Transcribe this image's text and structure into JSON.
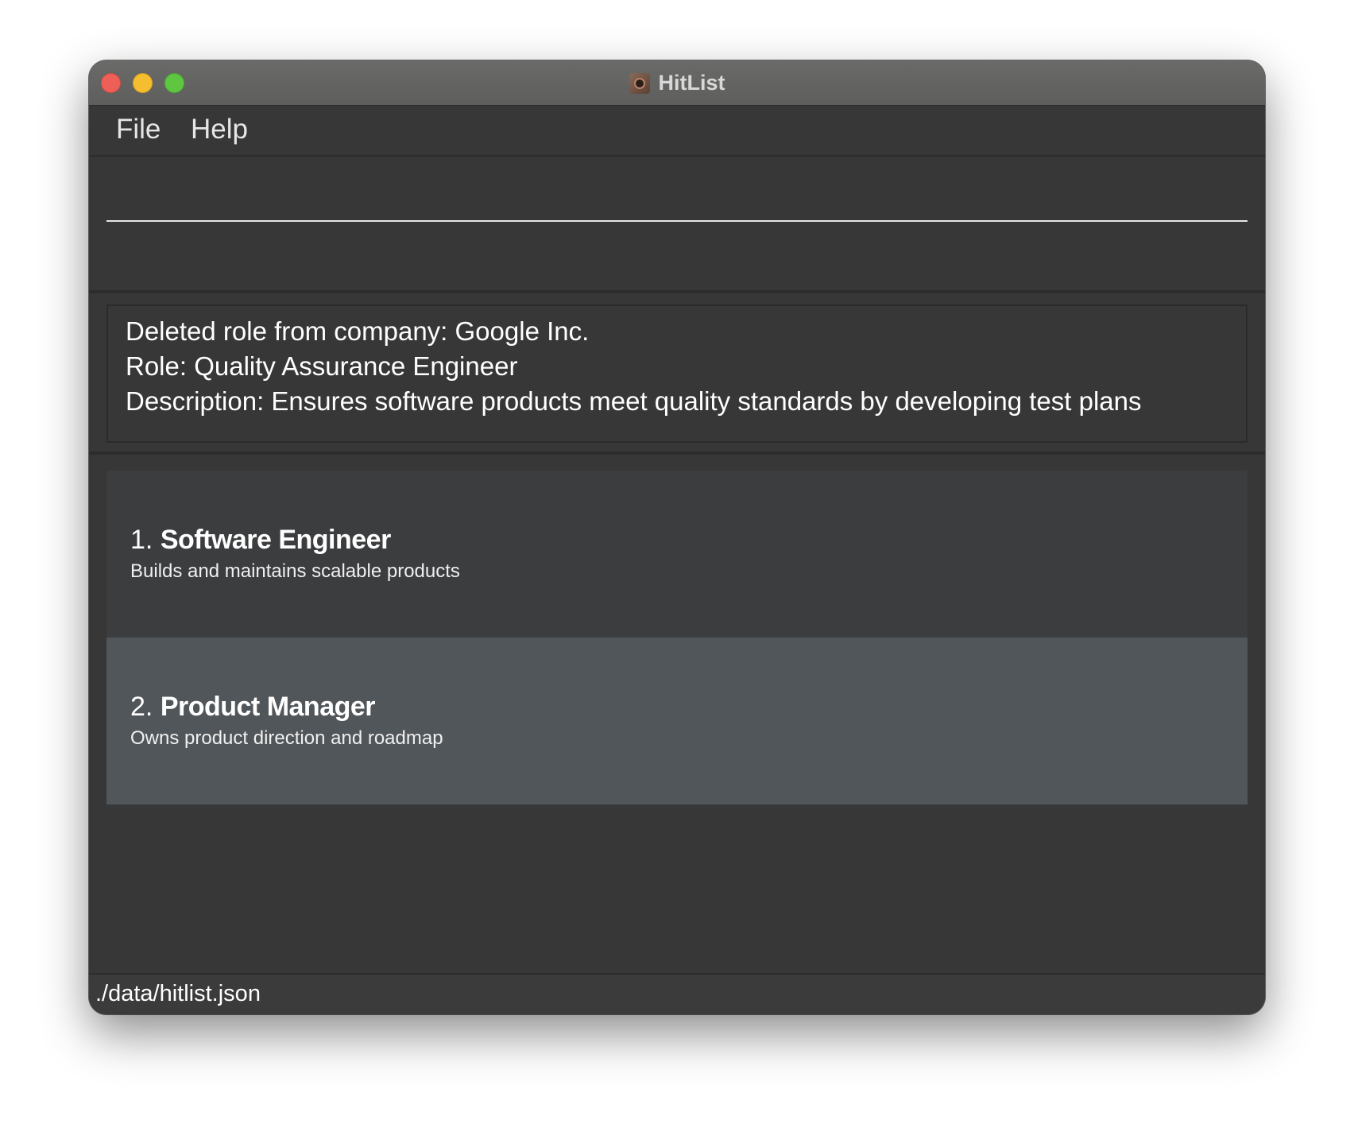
{
  "window": {
    "title": "HitList",
    "app_icon": "hitlist-app-icon"
  },
  "menu": {
    "file_label": "File",
    "help_label": "Help"
  },
  "command": {
    "value": "",
    "placeholder": ""
  },
  "result": {
    "lines": [
      "Deleted role from company: Google Inc.",
      "Role: Quality Assurance Engineer",
      "Description: Ensures software products meet quality standards by developing test plans"
    ]
  },
  "roles": [
    {
      "index": "1.",
      "name": "Software Engineer",
      "description": "Builds and maintains scalable products"
    },
    {
      "index": "2.",
      "name": "Product Manager",
      "description": "Owns product direction and roadmap"
    }
  ],
  "status": {
    "file_path": "./data/hitlist.json"
  },
  "colors": {
    "window_bg": "#373737",
    "card_default": "#3c3d3f",
    "card_selected": "#51565a",
    "close_button": "#ee5f57",
    "minimize_button": "#f5bd30",
    "maximize_button": "#5ec640"
  }
}
